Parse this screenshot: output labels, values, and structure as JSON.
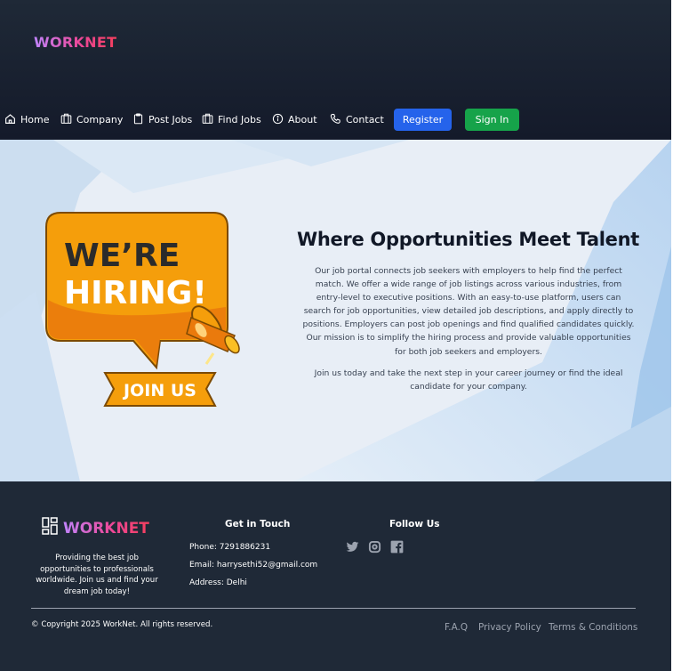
{
  "brand": {
    "name": "WORKNET"
  },
  "nav": {
    "items": [
      {
        "label": "Home",
        "icon": "home-icon"
      },
      {
        "label": "Company",
        "icon": "building-icon"
      },
      {
        "label": "Post Jobs",
        "icon": "clipboard-icon"
      },
      {
        "label": "Find Jobs",
        "icon": "building-icon"
      },
      {
        "label": "About",
        "icon": "info-icon"
      },
      {
        "label": "Contact",
        "icon": "phone-icon"
      }
    ],
    "register_label": "Register",
    "signin_label": "Sign In"
  },
  "colors": {
    "header_bg": "#1f2937",
    "register": "#2563eb",
    "signin": "#16a34a",
    "logo_gradient": [
      "#c084fc",
      "#ec4899",
      "#f43f5e"
    ],
    "hiring_bubble": "#f59e0b",
    "footer_bg": "#1f2937"
  },
  "hero": {
    "image": {
      "line1": "WE’RE",
      "line2": "HIRING!",
      "banner": "JOIN US"
    },
    "title": "Where Opportunities Meet Talent",
    "paragraph1": "Our job portal connects job seekers with employers to help find the perfect match. We offer a wide range of job listings across various industries, from entry-level to executive positions. With an easy-to-use platform, users can search for job opportunities, view detailed job descriptions, and apply directly to positions. Employers can post job openings and find qualified candidates quickly. Our mission is to simplify the hiring process and provide valuable opportunities for both job seekers and employers.",
    "paragraph2": "Join us today and take the next step in your career journey or find the ideal candidate for your company."
  },
  "footer": {
    "brand": "WORKNET",
    "description": "Providing the best job opportunities to professionals worldwide. Join us and find your dream job today!",
    "contact": {
      "heading": "Get in Touch",
      "phone_label": "Phone:",
      "phone": "7291886231",
      "email_label": "Email:",
      "email": "harrysethi52@gmail.com",
      "address_label": "Address:",
      "address": "Delhi"
    },
    "follow": {
      "heading": "Follow Us",
      "icons": [
        "twitter-icon",
        "instagram-icon",
        "facebook-icon"
      ]
    },
    "copyright": "© Copyright 2025 WorkNet. All rights reserved.",
    "links": [
      "F.A.Q",
      "Privacy Policy",
      "Terms & Conditions"
    ]
  }
}
